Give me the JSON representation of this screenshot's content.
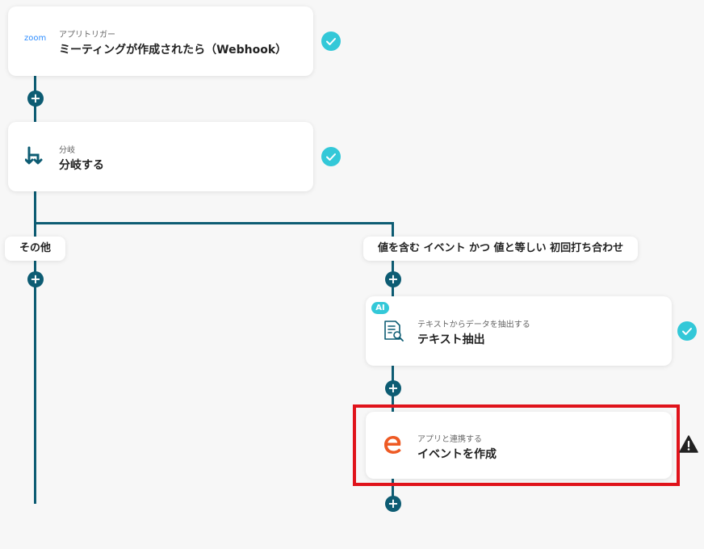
{
  "colors": {
    "accent": "#0d5c73",
    "check": "#33c8d8",
    "highlight": "#e0131b",
    "eventbrite": "#ee5a24"
  },
  "trigger_card": {
    "icon": "zoom-logo-icon",
    "logo_text": "zoom",
    "subtitle": "アプリトリガー",
    "title": "ミーティングが作成されたら（Webhook）"
  },
  "branch_card": {
    "icon": "branch-icon",
    "subtitle": "分岐",
    "title": "分岐する"
  },
  "branch_labels": {
    "left": "その他",
    "right": "値を含む イベント かつ 値と等しい 初回打ち合わせ"
  },
  "extract_card": {
    "icon": "document-search-icon",
    "badge": "AI",
    "subtitle": "テキストからデータを抽出する",
    "title": "テキスト抽出"
  },
  "event_card": {
    "icon": "eventbrite-logo-icon",
    "subtitle": "アプリと連携する",
    "title": "イベントを作成"
  },
  "add_step_symbol": "+"
}
